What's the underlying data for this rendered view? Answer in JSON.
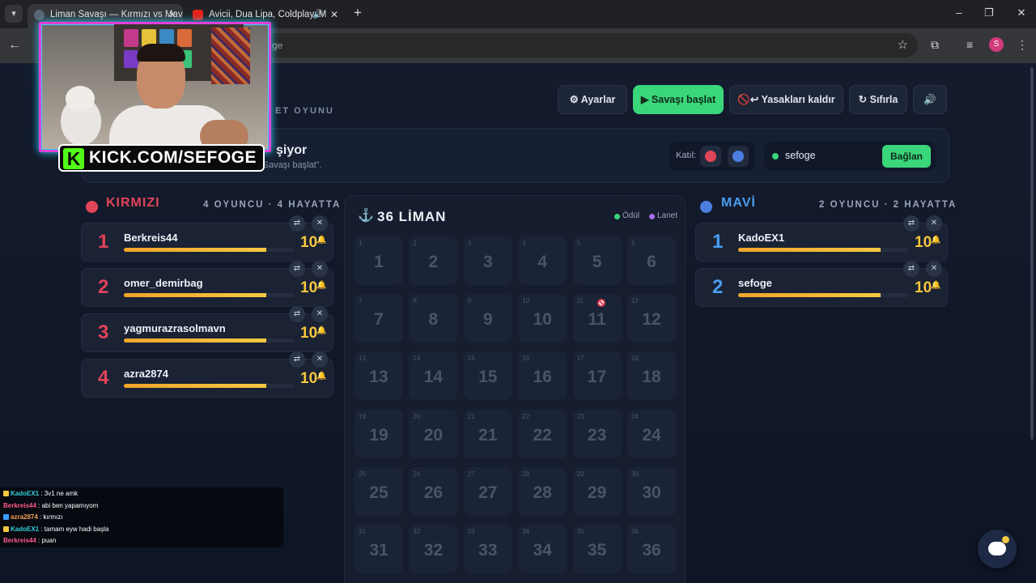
{
  "browser": {
    "tabs": [
      {
        "title": "Liman Savaşı — Kırmızı vs Mavi",
        "active": true
      },
      {
        "title": "Avicii, Dua Lipa, Coldplay, M",
        "active": false,
        "audio": true
      }
    ],
    "address_fragment": "ge",
    "profile_initial": "S"
  },
  "header": {
    "subtitle": "ET OYUNU",
    "buttons": {
      "settings": "⚙ Ayarlar",
      "start": "▶ Savaşı başlat",
      "remove_bans": "🚫↩ Yasakları kaldır",
      "reset": "↻ Sıfırla",
      "sound": "🔊"
    }
  },
  "status": {
    "title": "şiyor",
    "message": "“Savaşı başlat”.",
    "join_label": "Katıl:",
    "channel": "sefoge",
    "connect_label": "Bağlan"
  },
  "teams": {
    "red": {
      "name": "KIRMIZI",
      "meta": "4 OYUNCU · 4 HAYATTA",
      "color": "#e24458",
      "players": [
        {
          "rank": "1",
          "name": "Berkreis44",
          "lives": "10",
          "hp": 0.84
        },
        {
          "rank": "2",
          "name": "omer_demirbag",
          "lives": "10",
          "hp": 0.84
        },
        {
          "rank": "3",
          "name": "yagmurazrasolmavn",
          "lives": "10",
          "hp": 0.84
        },
        {
          "rank": "4",
          "name": "azra2874",
          "lives": "10",
          "hp": 0.84
        }
      ]
    },
    "blue": {
      "name": "MAVİ",
      "meta": "2 OYUNCU · 2 HAYATTA",
      "color": "#4a9ef0",
      "players": [
        {
          "rank": "1",
          "name": "KadoEX1",
          "lives": "10",
          "hp": 0.84
        },
        {
          "rank": "2",
          "name": "sefoge",
          "lives": "10",
          "hp": 0.84
        }
      ]
    }
  },
  "ports": {
    "title": "36 LİMAN",
    "legend": [
      {
        "label": "Ödül",
        "color": "#3ad67a"
      },
      {
        "label": "Lanet",
        "color": "#a86cf0"
      }
    ],
    "cells": [
      "1",
      "2",
      "3",
      "4",
      "5",
      "6",
      "7",
      "8",
      "9",
      "10",
      "11",
      "12",
      "13",
      "14",
      "15",
      "16",
      "17",
      "18",
      "19",
      "20",
      "21",
      "22",
      "23",
      "24",
      "25",
      "26",
      "27",
      "28",
      "29",
      "30",
      "31",
      "32",
      "33",
      "34",
      "35",
      "36"
    ],
    "banned": "11"
  },
  "stream": {
    "kick_logo": "K",
    "kick_url": "KICK.COM/SEFOGE"
  },
  "chat": [
    {
      "user": "KadoEX1",
      "color": "#35d0d8",
      "badge": "#f5c842",
      "text": " : 3v1 ne amk"
    },
    {
      "user": "Berkreis44",
      "color": "#ff5a8a",
      "badge": "",
      "text": " : abi ben yapamıyom"
    },
    {
      "user": "azra2874",
      "color": "#f5a25a",
      "badge": "#3aa0ff",
      "text": " : kırmızı"
    },
    {
      "user": "KadoEX1",
      "color": "#35d0d8",
      "badge": "#f5c842",
      "text": " : tamam eyw hadi başla"
    },
    {
      "user": "Berkreis44",
      "color": "#ff5a8a",
      "badge": "",
      "text": " : puan"
    }
  ]
}
